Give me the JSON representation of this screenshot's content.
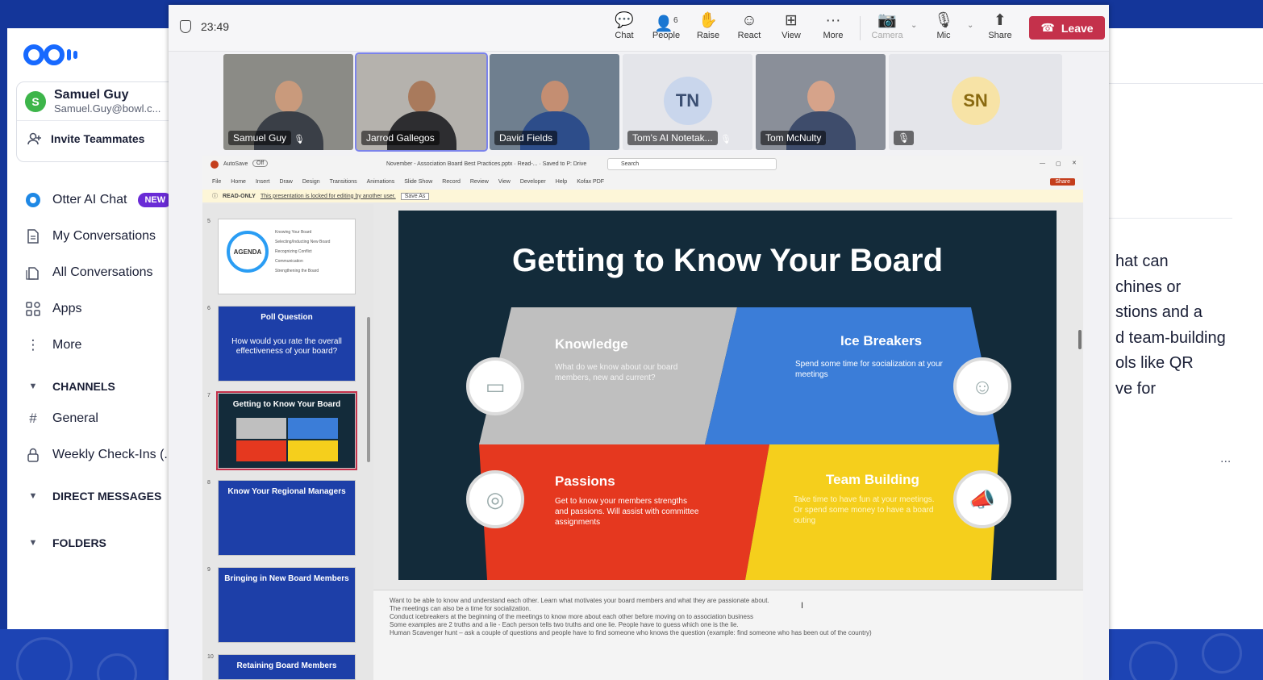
{
  "otter": {
    "user": {
      "initial": "S",
      "name": "Samuel Guy",
      "email": "Samuel.Guy@bowl.c..."
    },
    "invite_label": "Invite Teammates",
    "nav": [
      {
        "label": "Otter AI Chat",
        "icon": "otter-chat-icon",
        "badge": "NEW"
      },
      {
        "label": "My Conversations",
        "icon": "document-icon"
      },
      {
        "label": "All Conversations",
        "icon": "documents-icon"
      },
      {
        "label": "Apps",
        "icon": "apps-grid-icon"
      },
      {
        "label": "More",
        "icon": "more-vertical-icon"
      }
    ],
    "channels_label": "CHANNELS",
    "channels": [
      {
        "label": "General",
        "icon": "hash-icon"
      },
      {
        "label": "Weekly Check-Ins (.",
        "icon": "lock-icon"
      }
    ],
    "direct_messages_label": "DIRECT MESSAGES",
    "folders_label": "FOLDERS",
    "right_panel_text": "hat can\nchines or\nstions and a\nd team-building\nols like QR\nve for",
    "right_panel_more": "..."
  },
  "teams": {
    "timer": "23:49",
    "toolbar": {
      "chat": "Chat",
      "people": "People",
      "people_count": "6",
      "raise": "Raise",
      "react": "React",
      "view": "View",
      "more": "More",
      "camera": "Camera",
      "mic": "Mic",
      "share": "Share",
      "leave": "Leave"
    },
    "participants": [
      {
        "name": "Samuel Guy",
        "muted": true,
        "type": "video"
      },
      {
        "name": "Jarrod Gallegos",
        "muted": false,
        "type": "video",
        "active": true
      },
      {
        "name": "David Fields",
        "muted": false,
        "type": "video"
      },
      {
        "name": "Tom's AI Notetak...",
        "initials": "TN",
        "muted": true,
        "type": "avatar"
      },
      {
        "name": "Tom McNulty",
        "muted": false,
        "type": "video"
      },
      {
        "name": "",
        "initials": "SN",
        "muted": true,
        "type": "avatar"
      }
    ]
  },
  "ppt": {
    "autosave": "AutoSave",
    "autosave_state": "Off",
    "file_title": "November - Association Board Best Practices.pptx  ·  Read-...  ·  Saved to P: Drive",
    "search_placeholder": "Search",
    "share_label": "Share",
    "menu": [
      "File",
      "Home",
      "Insert",
      "Draw",
      "Design",
      "Transitions",
      "Animations",
      "Slide Show",
      "Record",
      "Review",
      "View",
      "Developer",
      "Help",
      "Kofax PDF"
    ],
    "readonly_label": "READ-ONLY",
    "readonly_msg": "This presentation is locked for editing by another user.",
    "save_as": "Save As",
    "thumbnails": [
      {
        "num": "5",
        "title": "AGENDA",
        "items": [
          "Knowing Your Board",
          "Selecting/Inducting New Board",
          "Recognizing Conflict",
          "Communication",
          "Strengthening the Board"
        ]
      },
      {
        "num": "6",
        "title": "Poll Question",
        "subtitle": "How would you rate the overall effectiveness of your board?"
      },
      {
        "num": "7",
        "title": "Getting to Know Your Board",
        "selected": true
      },
      {
        "num": "8",
        "title": "Know Your Regional Managers"
      },
      {
        "num": "9",
        "title": "Bringing in New Board Members"
      },
      {
        "num": "10",
        "title": "Retaining Board Members"
      }
    ],
    "slide": {
      "title": "Getting to Know Your Board",
      "quadrants": [
        {
          "title": "Knowledge",
          "text": "What do we know about our board members, new and current?",
          "color": "#bfbfbf",
          "icon": "presentation-icon"
        },
        {
          "title": "Ice Breakers",
          "text": "Spend some time for socialization at your meetings",
          "color": "#3b7dd8",
          "icon": "user-badge-icon"
        },
        {
          "title": "Passions",
          "text": "Get to know your members strengths and passions. Will assist with committee assignments",
          "color": "#e5381f",
          "icon": "target-icon"
        },
        {
          "title": "Team Building",
          "text": "Take time to have fun at your meetings. Or spend some money to have a board outing",
          "color": "#f5cf1c",
          "icon": "megaphone-icon"
        }
      ]
    },
    "notes": [
      "Want to be able to know and understand each other. Learn what motivates your board members and what they are passionate about.",
      "The meetings can also be a time for socialization.",
      "Conduct icebreakers at the beginning of the meetings to know more about each other before moving on to association business",
      "Some examples are 2 truths and a lie - Each person tells two truths and one lie. People have to guess which one is the lie.",
      "Human Scavenger hunt – ask a couple of questions and people have to find someone who knows the question (example: find someone who has been out of the country)"
    ]
  }
}
